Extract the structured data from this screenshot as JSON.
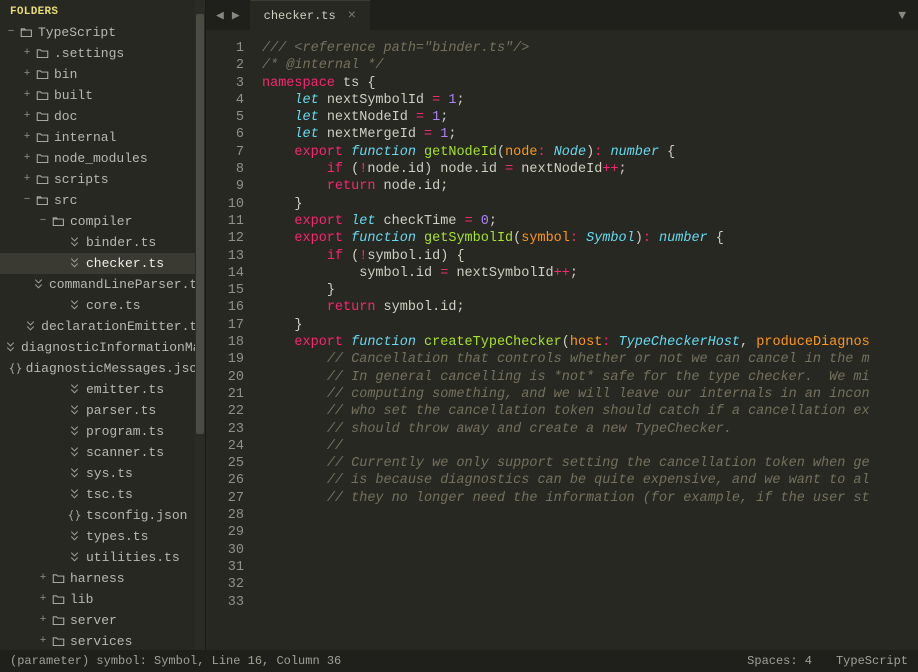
{
  "sidebar": {
    "header": "FOLDERS",
    "root": {
      "name": "TypeScript",
      "expanded": true,
      "icon": "folder-open",
      "children": [
        {
          "name": ".settings",
          "icon": "folder",
          "expander": "+",
          "indent": 1
        },
        {
          "name": "bin",
          "icon": "folder",
          "expander": "+",
          "indent": 1
        },
        {
          "name": "built",
          "icon": "folder",
          "expander": "+",
          "indent": 1
        },
        {
          "name": "doc",
          "icon": "folder",
          "expander": "+",
          "indent": 1
        },
        {
          "name": "internal",
          "icon": "folder",
          "expander": "+",
          "indent": 1
        },
        {
          "name": "node_modules",
          "icon": "folder",
          "expander": "+",
          "indent": 1
        },
        {
          "name": "scripts",
          "icon": "folder",
          "expander": "+",
          "indent": 1
        },
        {
          "name": "src",
          "icon": "folder-open",
          "expander": "−",
          "indent": 1
        },
        {
          "name": "compiler",
          "icon": "folder-open",
          "expander": "−",
          "indent": 2
        },
        {
          "name": "binder.ts",
          "icon": "ts",
          "expander": "",
          "indent": 3
        },
        {
          "name": "checker.ts",
          "icon": "ts",
          "expander": "",
          "indent": 3,
          "selected": true
        },
        {
          "name": "commandLineParser.ts",
          "icon": "ts",
          "expander": "",
          "indent": 3
        },
        {
          "name": "core.ts",
          "icon": "ts",
          "expander": "",
          "indent": 3
        },
        {
          "name": "declarationEmitter.ts",
          "icon": "ts",
          "expander": "",
          "indent": 3
        },
        {
          "name": "diagnosticInformationMap.generated.ts",
          "icon": "ts",
          "expander": "",
          "indent": 3
        },
        {
          "name": "diagnosticMessages.json",
          "icon": "json",
          "expander": "",
          "indent": 3
        },
        {
          "name": "emitter.ts",
          "icon": "ts",
          "expander": "",
          "indent": 3
        },
        {
          "name": "parser.ts",
          "icon": "ts",
          "expander": "",
          "indent": 3
        },
        {
          "name": "program.ts",
          "icon": "ts",
          "expander": "",
          "indent": 3
        },
        {
          "name": "scanner.ts",
          "icon": "ts",
          "expander": "",
          "indent": 3
        },
        {
          "name": "sys.ts",
          "icon": "ts",
          "expander": "",
          "indent": 3
        },
        {
          "name": "tsc.ts",
          "icon": "ts",
          "expander": "",
          "indent": 3
        },
        {
          "name": "tsconfig.json",
          "icon": "json",
          "expander": "",
          "indent": 3
        },
        {
          "name": "types.ts",
          "icon": "ts",
          "expander": "",
          "indent": 3
        },
        {
          "name": "utilities.ts",
          "icon": "ts",
          "expander": "",
          "indent": 3
        },
        {
          "name": "harness",
          "icon": "folder",
          "expander": "+",
          "indent": 2
        },
        {
          "name": "lib",
          "icon": "folder",
          "expander": "+",
          "indent": 2
        },
        {
          "name": "server",
          "icon": "folder",
          "expander": "+",
          "indent": 2
        },
        {
          "name": "services",
          "icon": "folder",
          "expander": "+",
          "indent": 2
        }
      ]
    }
  },
  "tabs": {
    "active": "checker.ts"
  },
  "code": {
    "firstLine": 1,
    "lines": [
      [
        [
          "comment",
          "/// <reference path=\"binder.ts\"/>"
        ]
      ],
      [
        [
          "",
          ""
        ]
      ],
      [
        [
          "comment",
          "/* @internal */"
        ]
      ],
      [
        [
          "storage",
          "namespace"
        ],
        [
          "",
          " "
        ],
        [
          "punct",
          "ts"
        ],
        [
          "",
          " "
        ],
        [
          "punct",
          "{"
        ]
      ],
      [
        [
          "",
          "    "
        ],
        [
          "keyword",
          "let"
        ],
        [
          "",
          " nextSymbolId "
        ],
        [
          "op",
          "="
        ],
        [
          "",
          " "
        ],
        [
          "num",
          "1"
        ],
        [
          "punct",
          ";"
        ]
      ],
      [
        [
          "",
          "    "
        ],
        [
          "keyword",
          "let"
        ],
        [
          "",
          " nextNodeId "
        ],
        [
          "op",
          "="
        ],
        [
          "",
          " "
        ],
        [
          "num",
          "1"
        ],
        [
          "punct",
          ";"
        ]
      ],
      [
        [
          "",
          "    "
        ],
        [
          "keyword",
          "let"
        ],
        [
          "",
          " nextMergeId "
        ],
        [
          "op",
          "="
        ],
        [
          "",
          " "
        ],
        [
          "num",
          "1"
        ],
        [
          "punct",
          ";"
        ]
      ],
      [
        [
          "",
          ""
        ]
      ],
      [
        [
          "",
          "    "
        ],
        [
          "storage",
          "export"
        ],
        [
          "",
          " "
        ],
        [
          "keyword",
          "function"
        ],
        [
          "",
          " "
        ],
        [
          "func",
          "getNodeId"
        ],
        [
          "punct",
          "("
        ],
        [
          "name",
          "node"
        ],
        [
          "op",
          ":"
        ],
        [
          "",
          " "
        ],
        [
          "keyword",
          "Node"
        ],
        [
          "punct",
          ")"
        ],
        [
          "op",
          ":"
        ],
        [
          "",
          " "
        ],
        [
          "keyword",
          "number"
        ],
        [
          "",
          " "
        ],
        [
          "punct",
          "{"
        ]
      ],
      [
        [
          "",
          "        "
        ],
        [
          "storage",
          "if"
        ],
        [
          "",
          " "
        ],
        [
          "punct",
          "("
        ],
        [
          "op",
          "!"
        ],
        [
          "",
          "node.id"
        ],
        [
          "punct",
          ")"
        ],
        [
          "",
          " node.id "
        ],
        [
          "op",
          "="
        ],
        [
          "",
          " nextNodeId"
        ],
        [
          "op",
          "++"
        ],
        [
          "punct",
          ";"
        ]
      ],
      [
        [
          "",
          "        "
        ],
        [
          "storage",
          "return"
        ],
        [
          "",
          " node.id"
        ],
        [
          "punct",
          ";"
        ]
      ],
      [
        [
          "",
          "    "
        ],
        [
          "punct",
          "}"
        ]
      ],
      [
        [
          "",
          ""
        ]
      ],
      [
        [
          "",
          "    "
        ],
        [
          "storage",
          "export"
        ],
        [
          "",
          " "
        ],
        [
          "keyword",
          "let"
        ],
        [
          "",
          " checkTime "
        ],
        [
          "op",
          "="
        ],
        [
          "",
          " "
        ],
        [
          "num",
          "0"
        ],
        [
          "punct",
          ";"
        ]
      ],
      [
        [
          "",
          ""
        ]
      ],
      [
        [
          "",
          "    "
        ],
        [
          "storage",
          "export"
        ],
        [
          "",
          " "
        ],
        [
          "keyword",
          "function"
        ],
        [
          "",
          " "
        ],
        [
          "func",
          "getSymbolId"
        ],
        [
          "punct",
          "("
        ],
        [
          "name",
          "symbol"
        ],
        [
          "op",
          ":"
        ],
        [
          "",
          " "
        ],
        [
          "keyword",
          "Symbol"
        ],
        [
          "punct",
          ")"
        ],
        [
          "op",
          ":"
        ],
        [
          "",
          " "
        ],
        [
          "keyword",
          "number"
        ],
        [
          "",
          " "
        ],
        [
          "punct",
          "{"
        ]
      ],
      [
        [
          "",
          "        "
        ],
        [
          "storage",
          "if"
        ],
        [
          "",
          " "
        ],
        [
          "punct",
          "("
        ],
        [
          "op",
          "!"
        ],
        [
          "",
          "symbol.id"
        ],
        [
          "punct",
          ")"
        ],
        [
          "",
          " "
        ],
        [
          "punct",
          "{"
        ]
      ],
      [
        [
          "",
          "            symbol.id "
        ],
        [
          "op",
          "="
        ],
        [
          "",
          " nextSymbolId"
        ],
        [
          "op",
          "++"
        ],
        [
          "punct",
          ";"
        ]
      ],
      [
        [
          "",
          "        "
        ],
        [
          "punct",
          "}"
        ]
      ],
      [
        [
          "",
          ""
        ]
      ],
      [
        [
          "",
          "        "
        ],
        [
          "storage",
          "return"
        ],
        [
          "",
          " symbol.id"
        ],
        [
          "punct",
          ";"
        ]
      ],
      [
        [
          "",
          "    "
        ],
        [
          "punct",
          "}"
        ]
      ],
      [
        [
          "",
          ""
        ]
      ],
      [
        [
          "",
          "    "
        ],
        [
          "storage",
          "export"
        ],
        [
          "",
          " "
        ],
        [
          "keyword",
          "function"
        ],
        [
          "",
          " "
        ],
        [
          "func",
          "createTypeChecker"
        ],
        [
          "punct",
          "("
        ],
        [
          "name",
          "host"
        ],
        [
          "op",
          ":"
        ],
        [
          "",
          " "
        ],
        [
          "keyword",
          "TypeCheckerHost"
        ],
        [
          "punct",
          ","
        ],
        [
          "",
          " "
        ],
        [
          "name",
          "produceDiagnos"
        ]
      ],
      [
        [
          "",
          "        "
        ],
        [
          "comment",
          "// Cancellation that controls whether or not we can cancel in the m"
        ]
      ],
      [
        [
          "",
          "        "
        ],
        [
          "comment",
          "// In general cancelling is *not* safe for the type checker.  We mi"
        ]
      ],
      [
        [
          "",
          "        "
        ],
        [
          "comment",
          "// computing something, and we will leave our internals in an incon"
        ]
      ],
      [
        [
          "",
          "        "
        ],
        [
          "comment",
          "// who set the cancellation token should catch if a cancellation ex"
        ]
      ],
      [
        [
          "",
          "        "
        ],
        [
          "comment",
          "// should throw away and create a new TypeChecker."
        ]
      ],
      [
        [
          "",
          "        "
        ],
        [
          "comment",
          "//"
        ]
      ],
      [
        [
          "",
          "        "
        ],
        [
          "comment",
          "// Currently we only support setting the cancellation token when ge"
        ]
      ],
      [
        [
          "",
          "        "
        ],
        [
          "comment",
          "// is because diagnostics can be quite expensive, and we want to al"
        ]
      ],
      [
        [
          "",
          "        "
        ],
        [
          "comment",
          "// they no longer need the information (for example, if the user st"
        ]
      ]
    ]
  },
  "statusbar": {
    "left": "(parameter) symbol: Symbol, Line 16, Column 36",
    "spaces": "Spaces: 4",
    "language": "TypeScript"
  }
}
